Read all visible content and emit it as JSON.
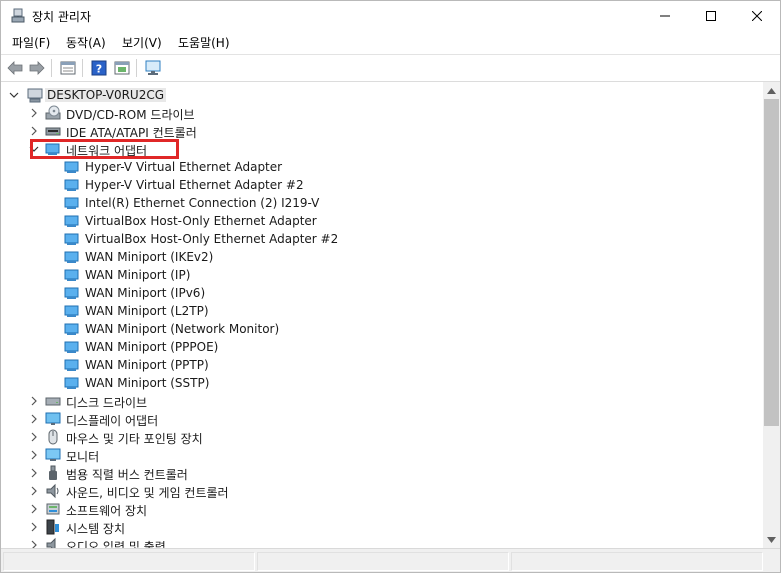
{
  "window": {
    "title": "장치 관리자",
    "controls": {
      "minimize": "—",
      "maximize": "☐",
      "close": "✕"
    }
  },
  "menu": {
    "file": "파일(F)",
    "action": "동작(A)",
    "view": "보기(V)",
    "help": "도움말(H)"
  },
  "toolbar": {
    "icons": [
      "back-arrow-icon",
      "forward-arrow-icon",
      "properties-icon",
      "help-icon",
      "update-driver-icon",
      "scan-monitor-icon"
    ]
  },
  "tree": {
    "root": "DESKTOP-V0RU2CG",
    "categories_before": [
      {
        "label": "DVD/CD-ROM 드라이브",
        "icon": "dvd-drive-icon"
      },
      {
        "label": "IDE ATA/ATAPI 컨트롤러",
        "icon": "ide-controller-icon"
      }
    ],
    "expanded": {
      "label": "네트워크 어댑터",
      "icon": "network-adapter-icon",
      "children": [
        "Hyper-V Virtual Ethernet Adapter",
        "Hyper-V Virtual Ethernet Adapter #2",
        "Intel(R) Ethernet Connection (2) I219-V",
        "VirtualBox Host-Only Ethernet Adapter",
        "VirtualBox Host-Only Ethernet Adapter #2",
        "WAN Miniport (IKEv2)",
        "WAN Miniport (IP)",
        "WAN Miniport (IPv6)",
        "WAN Miniport (L2TP)",
        "WAN Miniport (Network Monitor)",
        "WAN Miniport (PPPOE)",
        "WAN Miniport (PPTP)",
        "WAN Miniport (SSTP)"
      ]
    },
    "categories_after": [
      {
        "label": "디스크 드라이브",
        "icon": "disk-drive-icon"
      },
      {
        "label": "디스플레이 어댑터",
        "icon": "display-adapter-icon"
      },
      {
        "label": "마우스 및 기타 포인팅 장치",
        "icon": "mouse-icon"
      },
      {
        "label": "모니터",
        "icon": "monitor-icon"
      },
      {
        "label": "범용 직렬 버스 컨트롤러",
        "icon": "usb-controller-icon"
      },
      {
        "label": "사운드, 비디오 및 게임 컨트롤러",
        "icon": "speaker-icon"
      },
      {
        "label": "소프트웨어 장치",
        "icon": "software-device-icon"
      },
      {
        "label": "시스템 장치",
        "icon": "system-device-icon"
      },
      {
        "label": "오디오 입력 및 출력",
        "icon": "audio-io-icon"
      }
    ]
  },
  "colors": {
    "highlight_box": "#e02727",
    "network_icon": "#2f8fd8",
    "scroll_thumb": "#c2c2c2"
  }
}
